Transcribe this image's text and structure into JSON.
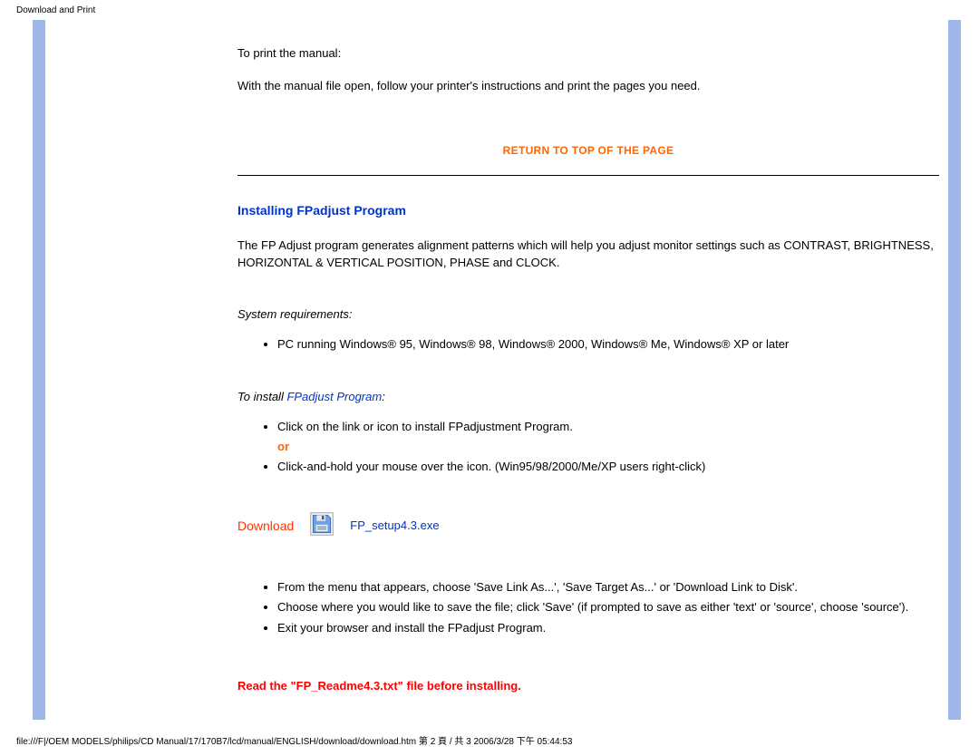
{
  "header": {
    "title": "Download and Print"
  },
  "intro": {
    "to_print": "To print the manual:",
    "print_instructions": "With the manual file open, follow your printer's instructions and print the pages you need."
  },
  "return_top": "RETURN TO TOP OF THE PAGE",
  "section": {
    "heading": "Installing FPadjust Program",
    "description": "The FP Adjust program generates alignment patterns which will help you adjust monitor settings such as CONTRAST, BRIGHTNESS, HORIZONTAL & VERTICAL POSITION, PHASE and CLOCK.",
    "sys_req_label": "System requirements:",
    "sys_req_item": "PC running Windows® 95, Windows® 98, Windows® 2000, Windows® Me, Windows® XP or later",
    "to_install_prefix": "To install ",
    "to_install_link": "FPadjust Program",
    "to_install_suffix": ":",
    "step_click": "Click on the link or icon to install FPadjustment Program.",
    "or": "or",
    "step_hold": "Click-and-hold your mouse over the icon. (Win95/98/2000/Me/XP users right-click)",
    "download_label": "Download",
    "download_file": "FP_setup4.3.exe",
    "step_menu": "From the menu that appears, choose 'Save Link As...', 'Save Target As...' or 'Download Link to Disk'.",
    "step_save": "Choose where you would like to save the file; click 'Save' (if prompted to save as either 'text' or 'source', choose 'source').",
    "step_exit": "Exit your browser and install the FPadjust Program.",
    "readme_warning": "Read the \"FP_Readme4.3.txt\" file before installing."
  },
  "footer": {
    "path": "file:///F|/OEM MODELS/philips/CD Manual/17/170B7/lcd/manual/ENGLISH/download/download.htm 第 2 頁 / 共 3 2006/3/28 下午 05:44:53"
  }
}
